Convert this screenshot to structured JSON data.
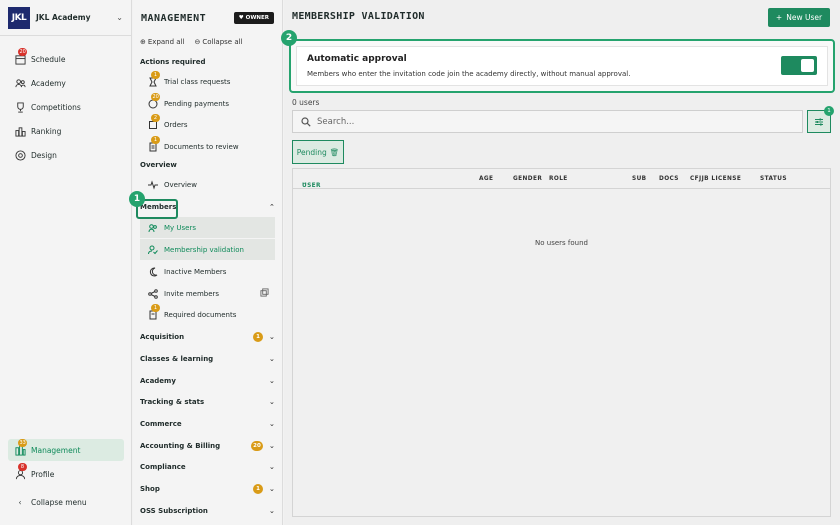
{
  "rail": {
    "logo": "JKL",
    "academy_name": "JKL Academy",
    "items": [
      {
        "label": "Schedule",
        "badge": "20"
      },
      {
        "label": "Academy",
        "badge": ""
      },
      {
        "label": "Competitions",
        "badge": ""
      },
      {
        "label": "Ranking",
        "badge": ""
      },
      {
        "label": "Design",
        "badge": ""
      }
    ],
    "bottom": [
      {
        "label": "Management",
        "badge": "33"
      },
      {
        "label": "Profile",
        "badge": "8"
      },
      {
        "label": "Collapse menu",
        "badge": ""
      }
    ]
  },
  "panel": {
    "title": "MANAGEMENT",
    "owner_badge": "OWNER",
    "expand_all": "Expand all",
    "collapse_all": "Collapse all",
    "actions_required": "Actions required",
    "actions": [
      {
        "label": "Trial class requests",
        "badge": "1"
      },
      {
        "label": "Pending payments",
        "badge": "20"
      },
      {
        "label": "Orders",
        "badge": "2"
      },
      {
        "label": "Documents to review",
        "badge": "1"
      }
    ],
    "overview_section": "Overview",
    "overview_item": "Overview",
    "members_section": "Members",
    "members": [
      {
        "label": "My Users"
      },
      {
        "label": "Membership validation"
      },
      {
        "label": "Inactive Members"
      },
      {
        "label": "Invite members"
      },
      {
        "label": "Required documents",
        "badge": "1"
      }
    ],
    "groups": [
      {
        "label": "Acquisition",
        "badge": "1"
      },
      {
        "label": "Classes & learning",
        "badge": ""
      },
      {
        "label": "Academy",
        "badge": ""
      },
      {
        "label": "Tracking & stats",
        "badge": ""
      },
      {
        "label": "Commerce",
        "badge": ""
      },
      {
        "label": "Accounting & Billing",
        "badge": "20"
      },
      {
        "label": "Compliance",
        "badge": ""
      },
      {
        "label": "Shop",
        "badge": "1"
      },
      {
        "label": "OSS Subscription",
        "badge": ""
      }
    ]
  },
  "steps": {
    "one": "1",
    "two": "2"
  },
  "main": {
    "title": "MEMBERSHIP VALIDATION",
    "new_user": "New User",
    "auto_title": "Automatic approval",
    "auto_desc": "Members who enter the invitation code join the academy directly, without manual approval.",
    "toggle_on": true,
    "users_count": "0 users",
    "search_placeholder": "Search...",
    "filter_count": "1",
    "chip": "Pending",
    "columns": [
      "USER",
      "AGE",
      "GENDER",
      "ROLE",
      "SUB",
      "DOCS",
      "CFJJB LICENSE",
      "STATUS"
    ],
    "empty": "No users found"
  },
  "colors": {
    "accent": "#1e8a5f",
    "badge_red": "#d8322b",
    "badge_gold": "#d99b17",
    "logo_bg": "#1e2a6e"
  }
}
